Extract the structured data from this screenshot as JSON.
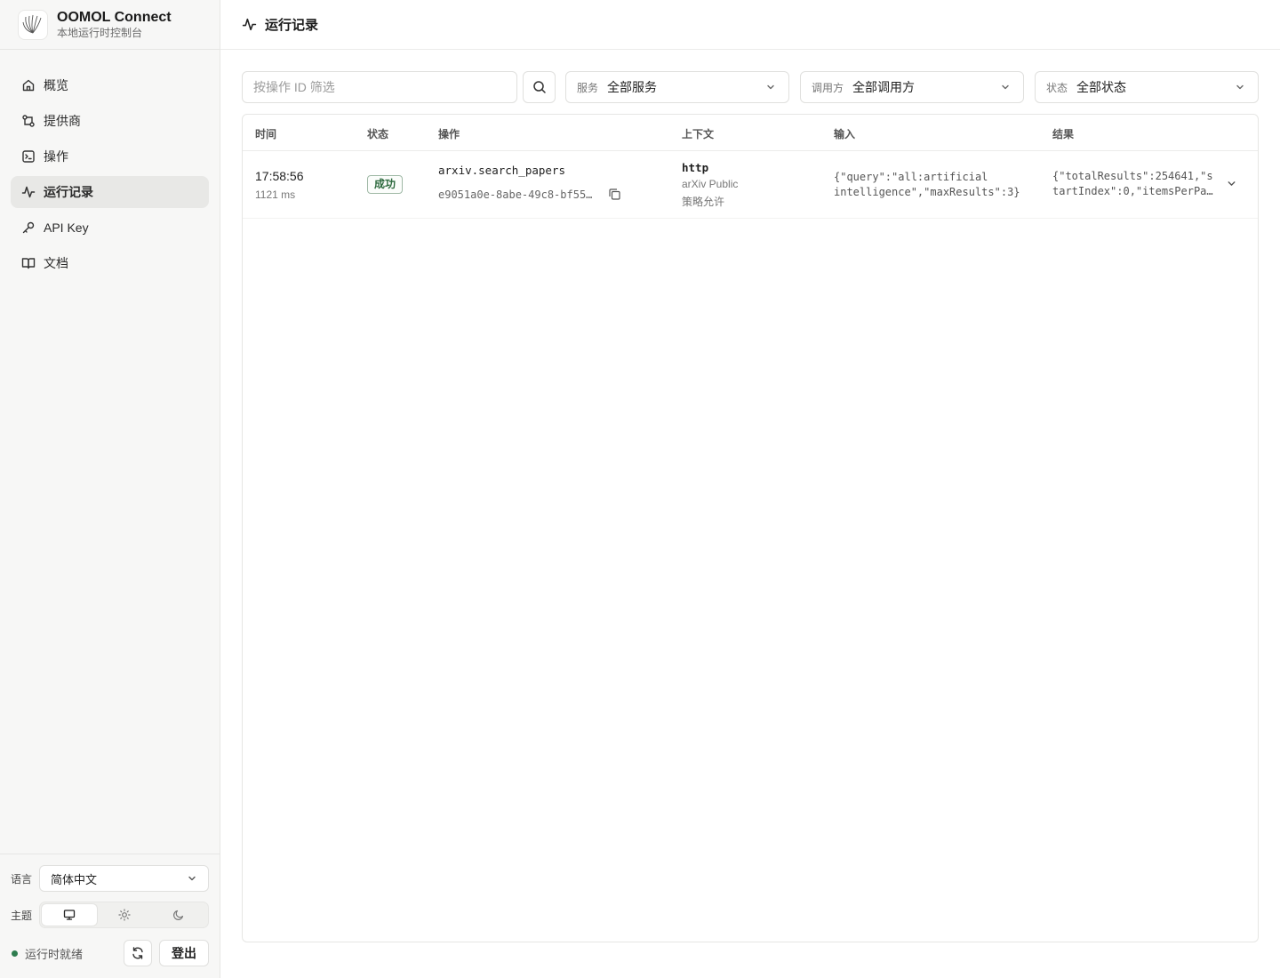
{
  "brand": {
    "title": "OOMOL Connect",
    "subtitle": "本地运行时控制台"
  },
  "nav": {
    "items": [
      {
        "label": "概览",
        "icon": "home-icon"
      },
      {
        "label": "提供商",
        "icon": "providers-icon"
      },
      {
        "label": "操作",
        "icon": "terminal-icon"
      },
      {
        "label": "运行记录",
        "icon": "activity-icon",
        "active": true
      },
      {
        "label": "API Key",
        "icon": "key-icon"
      },
      {
        "label": "文档",
        "icon": "book-icon"
      }
    ]
  },
  "sidebar_bottom": {
    "language_label": "语言",
    "language_value": "简体中文",
    "theme_label": "主题",
    "theme_options": [
      "monitor-icon",
      "sun-icon",
      "moon-icon"
    ],
    "theme_selected": "monitor-icon",
    "runtime_status": "运行时就绪",
    "status_color": "#2e7d4f",
    "logout_label": "登出"
  },
  "page": {
    "title": "运行记录",
    "icon": "activity-icon"
  },
  "filters": {
    "search_placeholder": "按操作 ID 筛选",
    "service_label": "服务",
    "service_value": "全部服务",
    "caller_label": "调用方",
    "caller_value": "全部调用方",
    "status_label": "状态",
    "status_value": "全部状态"
  },
  "table": {
    "columns": [
      "时间",
      "状态",
      "操作",
      "上下文",
      "输入",
      "结果"
    ],
    "rows": [
      {
        "time": "17:58:56",
        "duration": "1121 ms",
        "status": "成功",
        "status_color": "#2d6a3e",
        "operation": "arxiv.search_papers",
        "operation_id": "e9051a0e-8abe-49c8-bf55…",
        "context_type": "http",
        "context_source": "arXiv Public",
        "context_policy": "策略允许",
        "input_line1": "{\"query\":\"all:artificial",
        "input_line2": "intelligence\",\"maxResults\":3}",
        "result_line1": "{\"totalResults\":254641,\"s",
        "result_line2": "tartIndex\":0,\"itemsPerPa…"
      }
    ]
  }
}
